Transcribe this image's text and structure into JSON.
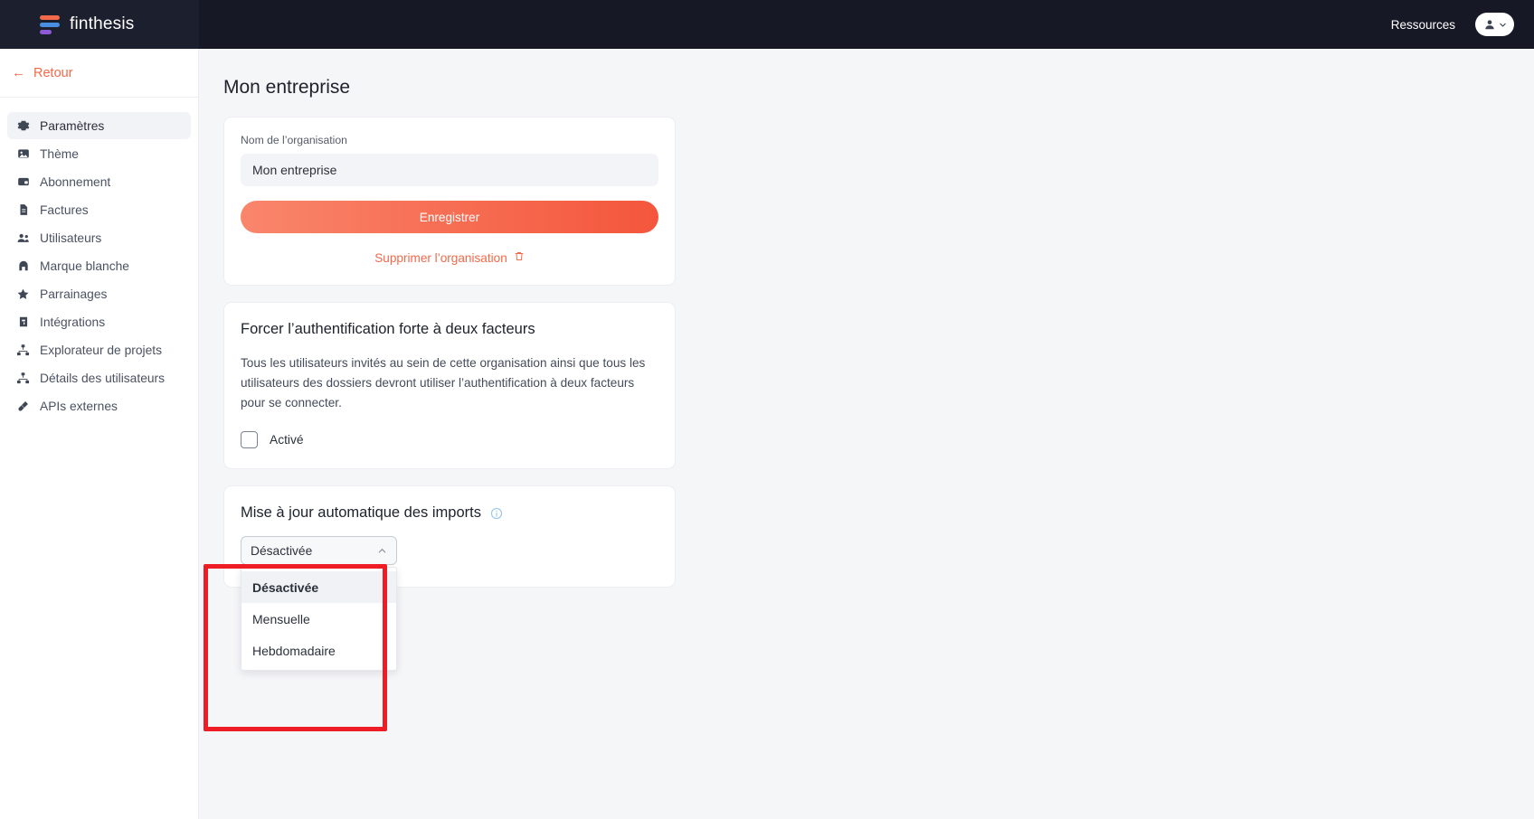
{
  "brand": {
    "name": "finthesis",
    "logo_icon": "finthesis-logo-bars"
  },
  "topbar": {
    "resources_label": "Ressources",
    "account_icon": "user-icon",
    "account_caret_icon": "chevron-down-icon"
  },
  "sidebar": {
    "back": {
      "label": "Retour",
      "icon": "arrow-left-icon"
    },
    "items": [
      {
        "label": "Paramètres",
        "icon": "gear-icon",
        "active": true
      },
      {
        "label": "Thème",
        "icon": "image-icon",
        "active": false
      },
      {
        "label": "Abonnement",
        "icon": "credit-card-icon",
        "active": false
      },
      {
        "label": "Factures",
        "icon": "document-icon",
        "active": false
      },
      {
        "label": "Utilisateurs",
        "icon": "users-icon",
        "active": false
      },
      {
        "label": "Marque blanche",
        "icon": "tag-icon",
        "active": false
      },
      {
        "label": "Parrainages",
        "icon": "star-icon",
        "active": false
      },
      {
        "label": "Intégrations",
        "icon": "puzzle-icon",
        "active": false
      },
      {
        "label": "Explorateur de projets",
        "icon": "hierarchy-icon",
        "active": false
      },
      {
        "label": "Détails des utilisateurs",
        "icon": "hierarchy-icon",
        "active": false
      },
      {
        "label": "APIs externes",
        "icon": "plug-icon",
        "active": false
      }
    ]
  },
  "main": {
    "page_title": "Mon entreprise",
    "org_card": {
      "field_label": "Nom de l’organisation",
      "org_name_value": "Mon entreprise",
      "org_name_placeholder": "Nom de l’organisation",
      "save_label": "Enregistrer",
      "delete_label": "Supprimer l’organisation",
      "delete_icon": "trash-icon"
    },
    "twofa_card": {
      "title": "Forcer l’authentification forte à deux facteurs",
      "description": "Tous les utilisateurs invités au sein de cette organisation ainsi que tous les utilisateurs des dossiers devront utiliser l’authentification à deux facteurs pour se connecter.",
      "checkbox_label": "Activé",
      "checkbox_checked": false
    },
    "autoupdate_card": {
      "title": "Mise à jour automatique des imports",
      "info_icon": "info-circle-icon",
      "select": {
        "value": "Désactivée",
        "expanded": true,
        "caret_icon": "chevron-up-icon",
        "options": [
          {
            "label": "Désactivée",
            "selected": true
          },
          {
            "label": "Mensuelle",
            "selected": false
          },
          {
            "label": "Hebdomadaire",
            "selected": false
          }
        ]
      }
    }
  },
  "colors": {
    "accent": "#f4694a",
    "topbar_bg": "#161925",
    "page_bg": "#f5f6f8",
    "annotation": "#ee1c25",
    "info_blue": "#9cc7e8"
  }
}
